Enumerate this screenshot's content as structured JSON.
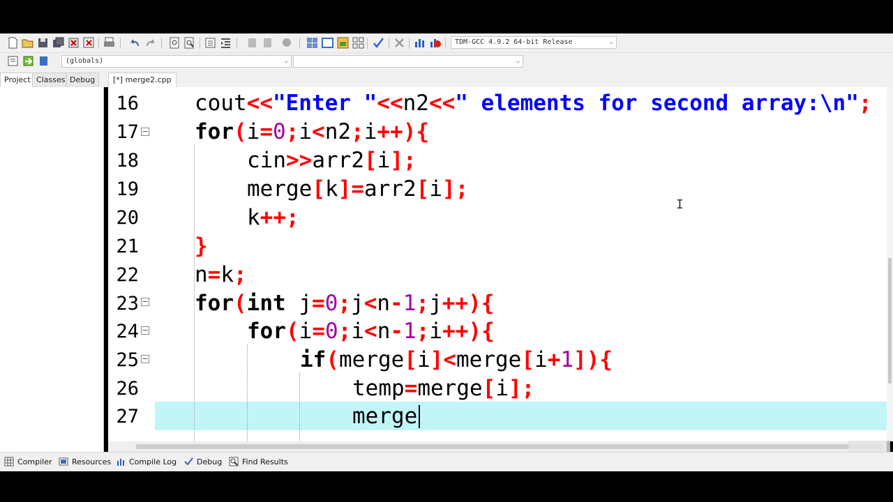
{
  "toolbar": {
    "compiler_select": "TDM-GCC 4.9.2 64-bit Release",
    "scope_select": "(globals)",
    "function_select": ""
  },
  "left_tabs": [
    "Project",
    "Classes",
    "Debug"
  ],
  "file_tab": "[*] merge2.cpp",
  "lines": [
    {
      "num": "16",
      "fold": false
    },
    {
      "num": "17",
      "fold": true
    },
    {
      "num": "18",
      "fold": false
    },
    {
      "num": "19",
      "fold": false
    },
    {
      "num": "20",
      "fold": false
    },
    {
      "num": "21",
      "fold": false
    },
    {
      "num": "22",
      "fold": false
    },
    {
      "num": "23",
      "fold": true
    },
    {
      "num": "24",
      "fold": true
    },
    {
      "num": "25",
      "fold": true
    },
    {
      "num": "26",
      "fold": false
    },
    {
      "num": "27",
      "fold": false
    }
  ],
  "code": {
    "l16_a": "cout",
    "l16_b": "<<",
    "l16_c": "\"Enter \"",
    "l16_d": "<<",
    "l16_e": "n2",
    "l16_f": "<<",
    "l16_g": "\" elements for second array:\\n\"",
    "l16_h": ";",
    "l17": "for(i=0;i<n2;i++){",
    "l18": "cin>>arr2[i];",
    "l19": "merge[k]=arr2[i];",
    "l20": "k++;",
    "l21": "}",
    "l22": "n=k;",
    "l23": "for(int j=0;j<n-1;j++){",
    "l24": "for(i=0;i<n-1;i++){",
    "l25": "if(merge[i]<merge[i+1]){",
    "l26": "temp=merge[i];",
    "l27": "merge"
  },
  "bottom_tabs": [
    "Compiler",
    "Resources",
    "Compile Log",
    "Debug",
    "Find Results"
  ],
  "colors": {
    "keyword": "#000000",
    "string": "#0000ff",
    "symbol": "#ff0000",
    "number": "#a000a0",
    "current_line": "#c2f5f8"
  }
}
